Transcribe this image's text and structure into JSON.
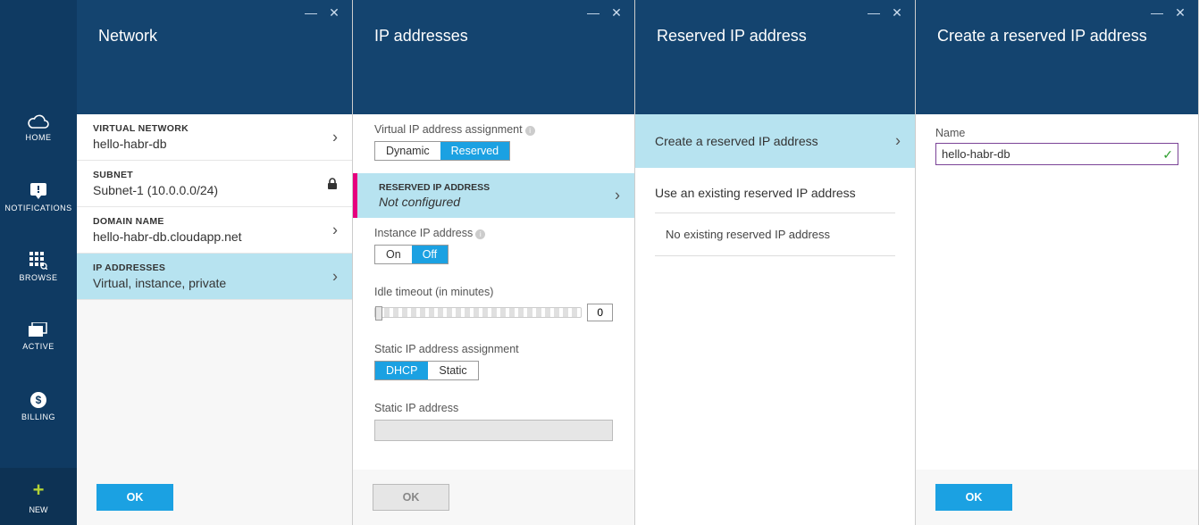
{
  "sidebar": {
    "items": [
      {
        "label": "HOME"
      },
      {
        "label": "NOTIFICATIONS"
      },
      {
        "label": "BROWSE"
      },
      {
        "label": "ACTIVE"
      },
      {
        "label": "BILLING"
      }
    ],
    "new_label": "NEW"
  },
  "blade1": {
    "title": "Network",
    "rows": [
      {
        "label": "VIRTUAL NETWORK",
        "value": "hello-habr-db"
      },
      {
        "label": "SUBNET",
        "value": "Subnet-1 (10.0.0.0/24)"
      },
      {
        "label": "DOMAIN NAME",
        "value": "hello-habr-db.cloudapp.net"
      },
      {
        "label": "IP ADDRESSES",
        "value": "Virtual, instance, private"
      }
    ],
    "ok": "OK"
  },
  "blade2": {
    "title": "IP addresses",
    "vip_label": "Virtual IP address assignment",
    "vip_options": [
      "Dynamic",
      "Reserved"
    ],
    "reserved_label": "RESERVED IP ADDRESS",
    "reserved_value": "Not configured",
    "instance_label": "Instance IP address",
    "instance_options": [
      "On",
      "Off"
    ],
    "idle_label": "Idle timeout (in minutes)",
    "idle_value": "0",
    "static_assign_label": "Static IP address assignment",
    "static_assign_options": [
      "DHCP",
      "Static"
    ],
    "static_ip_label": "Static IP address",
    "ok": "OK"
  },
  "blade3": {
    "title": "Reserved IP address",
    "create_label": "Create a reserved IP address",
    "use_existing": "Use an existing reserved IP address",
    "empty": "No existing reserved IP address"
  },
  "blade4": {
    "title": "Create a reserved IP address",
    "name_label": "Name",
    "name_value": "hello-habr-db",
    "ok": "OK"
  }
}
